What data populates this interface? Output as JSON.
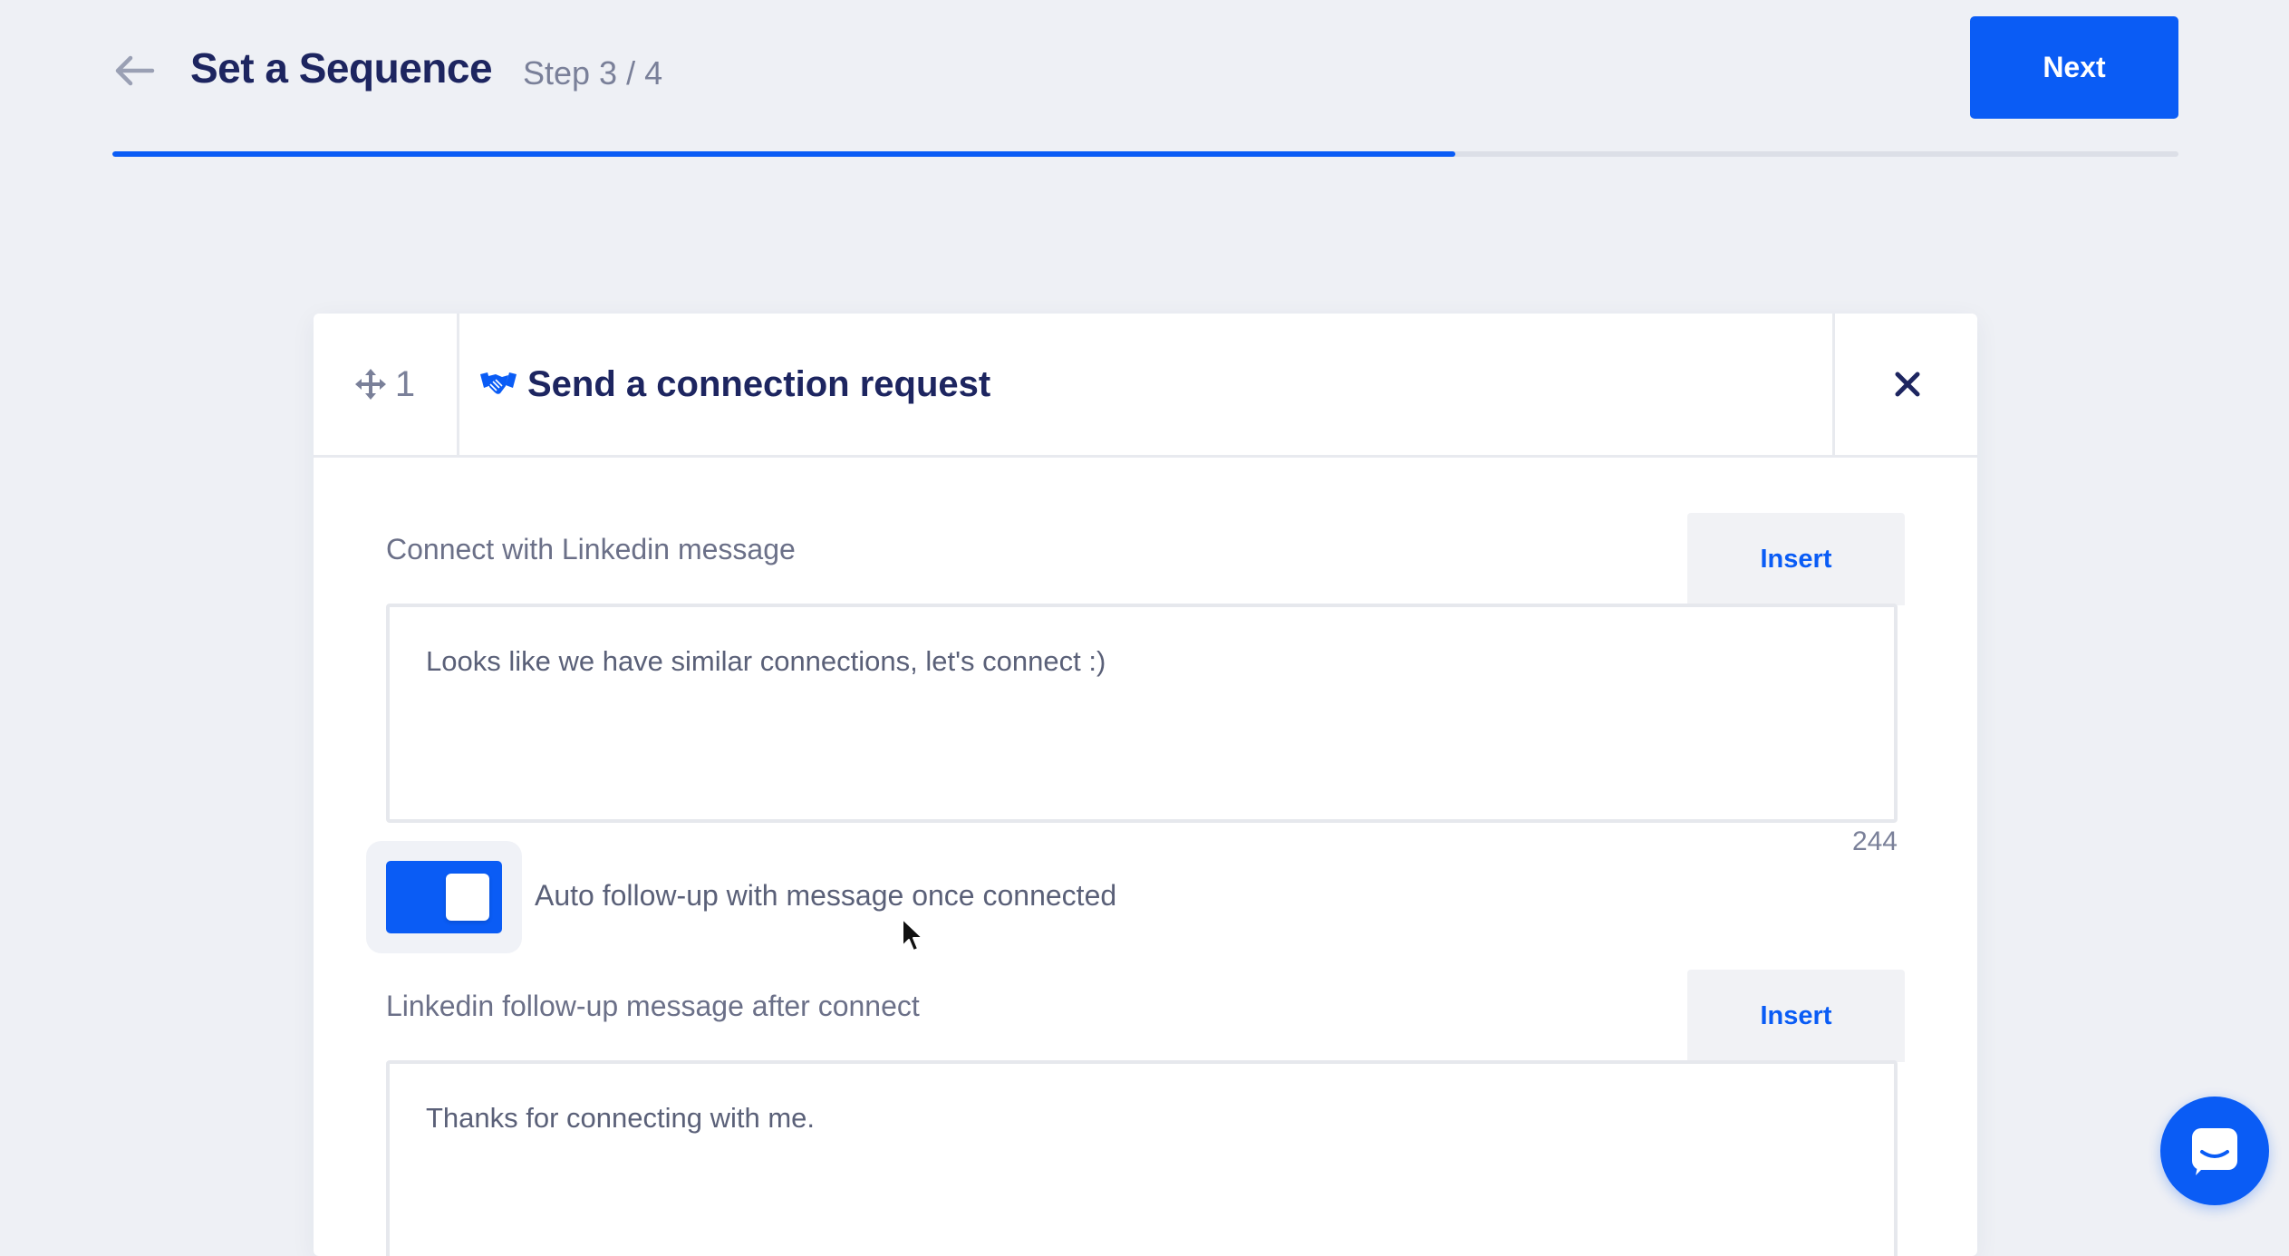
{
  "header": {
    "title": "Set a Sequence",
    "step": "Step 3 / 4",
    "next_label": "Next",
    "progress_fraction": 0.65
  },
  "card": {
    "step_number": "1",
    "title": "Send a connection request",
    "title_icon": "handshake-icon",
    "drag_icon": "move-icon",
    "close_icon": "close-icon"
  },
  "connect_message": {
    "label": "Connect with Linkedin message",
    "insert_label": "Insert",
    "value": "Looks like we have similar connections, let's connect :)",
    "char_count": "244"
  },
  "auto_follow_up": {
    "enabled": true,
    "label": "Auto follow-up with message once connected"
  },
  "follow_up_message": {
    "label": "Linkedin follow-up message after connect",
    "insert_label": "Insert",
    "value": "Thanks for connecting with me."
  },
  "colors": {
    "accent": "#0a5cf5",
    "title": "#1d2560",
    "background": "#eef0f5",
    "muted_text": "#6b7088"
  },
  "chat_launcher": {
    "icon": "chat-icon"
  }
}
